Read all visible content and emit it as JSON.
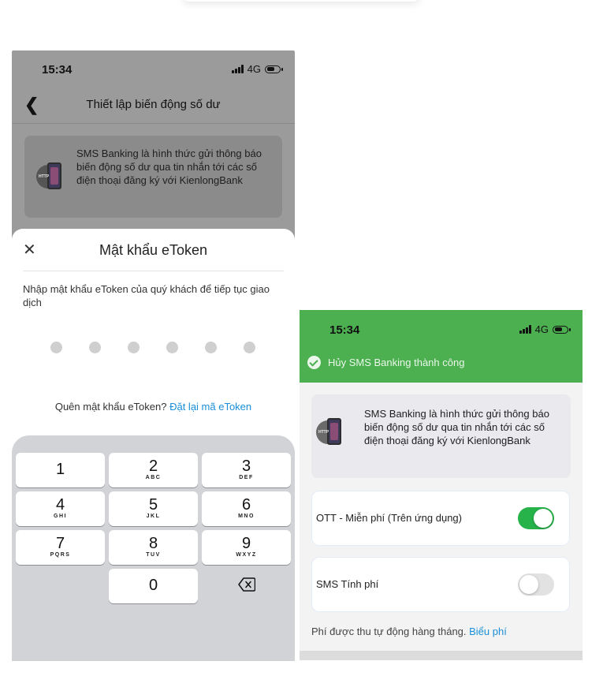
{
  "left_screen": {
    "status": {
      "time": "15:34",
      "network": "4G"
    },
    "nav": {
      "title": "Thiết lập biến động số dư"
    },
    "info_card": {
      "text": "SMS Banking là hình thức gửi thông báo biến động số dư qua tin nhắn tới các số điện thoại đăng ký với KienlongBank",
      "icon": "phone-http-icon"
    },
    "etoken_sheet": {
      "title": "Mật khẩu eToken",
      "instruction": "Nhập mật khẩu eToken của quý khách để tiếp tục giao dịch",
      "pin_length": 6,
      "forgot_text": "Quên mật khẩu eToken? ",
      "reset_link": "Đặt lại mã eToken"
    },
    "keypad": {
      "keys": [
        {
          "num": "1",
          "letters": ""
        },
        {
          "num": "2",
          "letters": "ABC"
        },
        {
          "num": "3",
          "letters": "DEF"
        },
        {
          "num": "4",
          "letters": "GHI"
        },
        {
          "num": "5",
          "letters": "JKL"
        },
        {
          "num": "6",
          "letters": "MNO"
        },
        {
          "num": "7",
          "letters": "PQRS"
        },
        {
          "num": "8",
          "letters": "TUV"
        },
        {
          "num": "9",
          "letters": "WXYZ"
        },
        {
          "num": "0",
          "letters": ""
        }
      ],
      "backspace_icon": "backspace-icon"
    }
  },
  "right_screen": {
    "status": {
      "time": "15:34",
      "network": "4G"
    },
    "toast": {
      "text": "Hủy SMS Banking thành công",
      "icon": "check-circle-icon"
    },
    "info_card": {
      "text": "SMS Banking là hình thức gửi thông báo biến động số dư qua tin nhắn tới các số điện thoại đăng ký với KienlongBank"
    },
    "options": [
      {
        "label": "OTT - Miễn phí (Trên ứng dụng)",
        "enabled": true
      },
      {
        "label": "SMS Tính phí",
        "enabled": false
      }
    ],
    "fee_note": "Phí được thu tự động hàng tháng. ",
    "fee_link": "Biểu phí"
  },
  "colors": {
    "accent_green": "#4caf50",
    "toggle_on": "#27b24a",
    "link_blue": "#1a8fd8"
  }
}
